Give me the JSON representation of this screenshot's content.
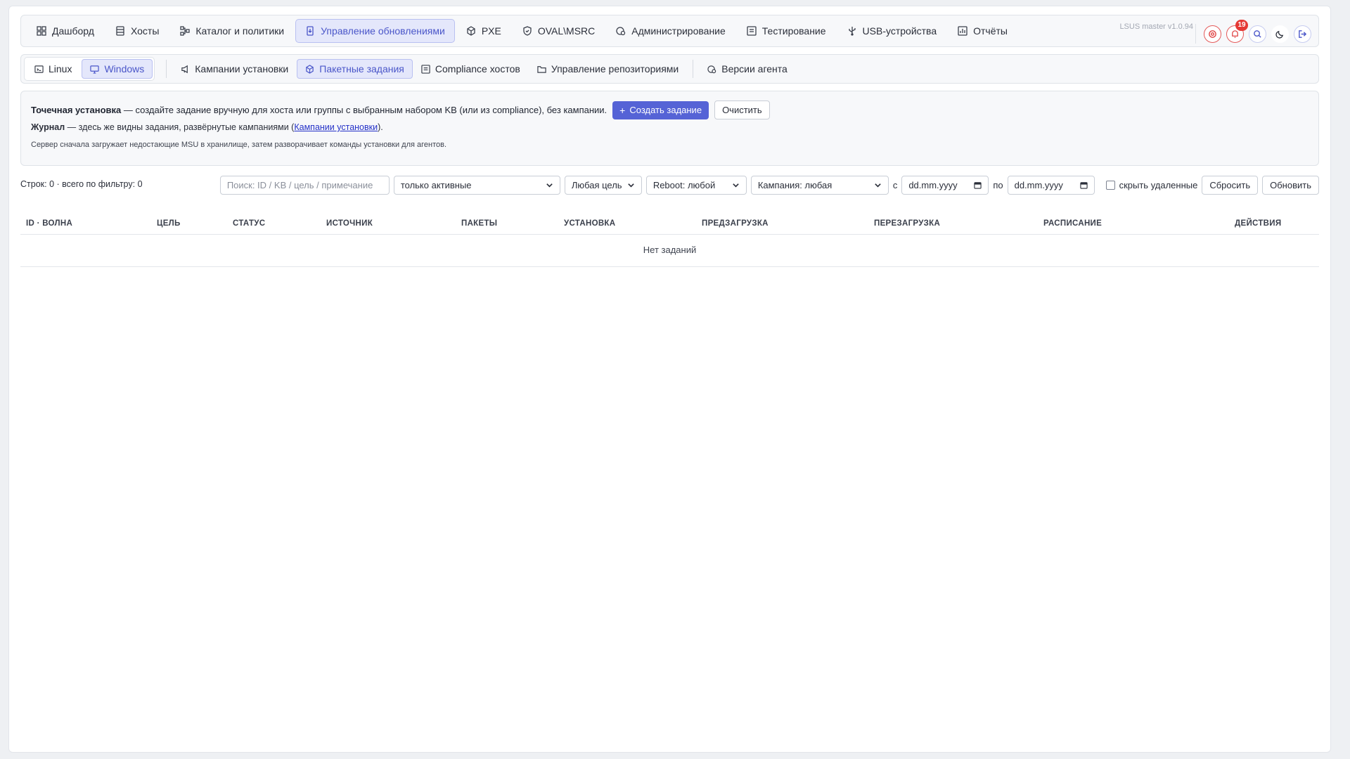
{
  "nav": {
    "items": [
      {
        "label": "Дашборд",
        "icon": "dashboard-icon"
      },
      {
        "label": "Хосты",
        "icon": "server-icon"
      },
      {
        "label": "Каталог и политики",
        "icon": "flow-icon"
      },
      {
        "label": "Управление обновлениями",
        "icon": "update-icon",
        "active": true
      },
      {
        "label": "PXE",
        "icon": "cube-icon"
      },
      {
        "label": "OVAL\\MSRC",
        "icon": "shield-icon"
      },
      {
        "label": "Администрирование",
        "icon": "admin-gear-icon"
      },
      {
        "label": "Тестирование",
        "icon": "test-icon"
      },
      {
        "label": "USB-устройства",
        "icon": "usb-icon"
      },
      {
        "label": "Отчёты",
        "icon": "report-icon"
      }
    ],
    "version": "LSUS master v1.0.94",
    "notifications_count": "19",
    "accent": "#5563d6"
  },
  "subnav": {
    "os": [
      {
        "label": "Linux",
        "icon": "terminal-icon"
      },
      {
        "label": "Windows",
        "icon": "monitor-icon",
        "active": true
      }
    ],
    "items": [
      {
        "label": "Кампании установки",
        "icon": "megaphone-icon"
      },
      {
        "label": "Пакетные задания",
        "icon": "package-icon",
        "active": true
      },
      {
        "label": "Compliance хостов",
        "icon": "checklist-icon"
      },
      {
        "label": "Управление репозиториями",
        "icon": "folder-icon"
      }
    ],
    "agent": {
      "label": "Версии агента",
      "icon": "agent-icon"
    }
  },
  "info": {
    "line1_bold": "Точечная установка",
    "line1_rest": " — создайте задание вручную для хоста или группы с выбранным набором KB (или из compliance), без кампании.",
    "create_label": "Создать задание",
    "clear_label": "Очистить",
    "line2_bold": "Журнал",
    "line2_rest": " — здесь же видны задания, развёрнутые кампаниями (",
    "line2_link": "Кампании установки",
    "line2_end": ").",
    "line3": "Сервер сначала загружает недостающие MSU в хранилище, затем разворачивает команды установки для агентов."
  },
  "filters": {
    "rows_count": "Строк: 0 · всего по фильтру: 0",
    "search_placeholder": "Поиск: ID / KB / цель / примечание",
    "status_value": "только активные",
    "target_value": "Любая цель",
    "reboot_value": "Reboot: любой",
    "campaign_value": "Кампания: любая",
    "from_label": "с",
    "date_placeholder": "dd.mm.yyyy",
    "to_label": "по",
    "hide_deleted_label": "скрыть удаленные",
    "reset_label": "Сбросить",
    "refresh_label": "Обновить"
  },
  "table": {
    "columns": [
      "ID · волна",
      "Цель",
      "Статус",
      "Источник",
      "Пакеты",
      "Установка",
      "Предзагрузка",
      "Перезагрузка",
      "Расписание",
      "Действия"
    ],
    "empty": "Нет заданий"
  }
}
